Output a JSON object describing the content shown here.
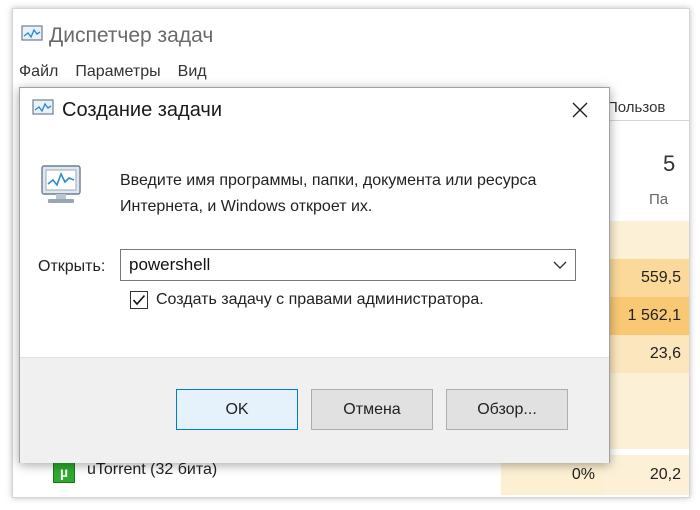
{
  "task_manager": {
    "title": "Диспетчер задач",
    "menu": [
      "Файл",
      "Параметры",
      "Вид"
    ],
    "users_tab": "Пользов",
    "column_value": "5",
    "column_label": "Па",
    "rows": [
      {
        "c1": "559,5",
        "c2": ""
      },
      {
        "c1": "1 562,1",
        "c2": ""
      },
      {
        "c1": "23,6",
        "c2": ""
      }
    ],
    "bottom_row": {
      "name": "uTorrent (32 бита)",
      "cpu": "0%",
      "mem": "20,2"
    },
    "colors": {
      "row_highlight_1": "#fbd99a",
      "row_highlight_2": "#f8e7bf",
      "row_highlight_3": "#fcf1d6"
    }
  },
  "dialog": {
    "title": "Создание задачи",
    "description": "Введите имя программы, папки, документа или ресурса Интернета, и Windows откроет их.",
    "open_label": "Открыть:",
    "open_value": "powershell",
    "checkbox_label": "Создать задачу с правами администратора.",
    "checkbox_checked": true,
    "buttons": {
      "ok": "OK",
      "cancel": "Отмена",
      "browse": "Обзор..."
    },
    "icons": {
      "title": "task-manager-icon",
      "body": "run-program-icon",
      "close": "close-icon",
      "dropdown": "chevron-down-icon",
      "check": "checkmark-icon"
    }
  }
}
